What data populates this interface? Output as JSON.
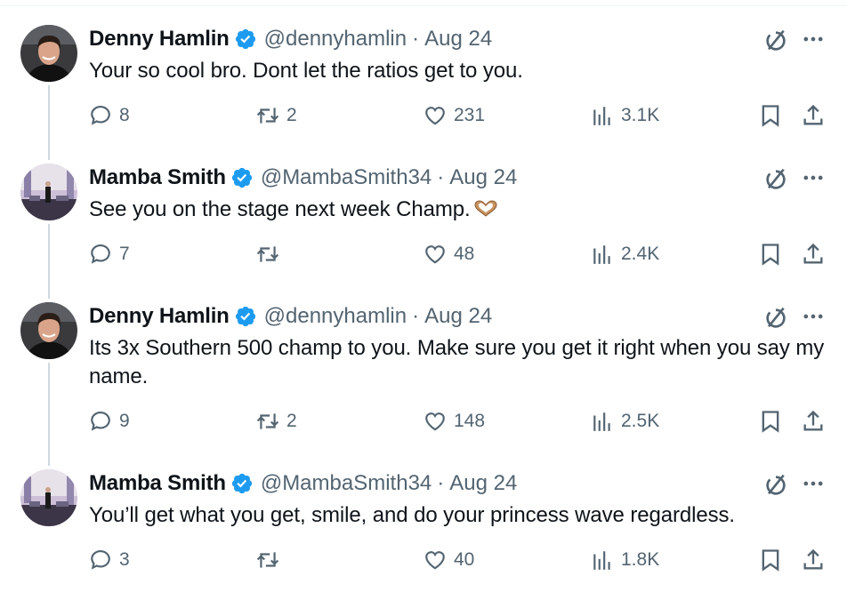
{
  "tweets": [
    {
      "name": "Denny Hamlin",
      "handle": "@dennyhamlin",
      "date": "Aug 24",
      "text": "Your so cool bro. Dont let the ratios get to you.",
      "replies": "8",
      "retweets": "2",
      "likes": "231",
      "views": "3.1K",
      "avatar": "denny"
    },
    {
      "name": "Mamba Smith",
      "handle": "@MambaSmith34",
      "date": "Aug 24",
      "text": "See you on the stage next week Champ.",
      "emoji": "heart-hands-emoji",
      "replies": "7",
      "retweets": "",
      "likes": "48",
      "views": "2.4K",
      "avatar": "mamba"
    },
    {
      "name": "Denny Hamlin",
      "handle": "@dennyhamlin",
      "date": "Aug 24",
      "text": "Its 3x Southern 500 champ to you. Make sure you get it right when you say my name.",
      "replies": "9",
      "retweets": "2",
      "likes": "148",
      "views": "2.5K",
      "avatar": "denny"
    },
    {
      "name": "Mamba Smith",
      "handle": "@MambaSmith34",
      "date": "Aug 24",
      "text": "You’ll get what you get, smile, and do your princess wave regardless.",
      "replies": "3",
      "retweets": "",
      "likes": "40",
      "views": "1.8K",
      "avatar": "mamba"
    }
  ],
  "separator": "·",
  "colors": {
    "text": "#0f1419",
    "secondary": "#536471",
    "verified": "#1d9bf0",
    "thread_line": "#cfd9de"
  },
  "icons": [
    "verified-badge-icon",
    "grok-icon",
    "more-icon",
    "reply-icon",
    "retweet-icon",
    "like-icon",
    "views-icon",
    "bookmark-icon",
    "share-icon"
  ]
}
